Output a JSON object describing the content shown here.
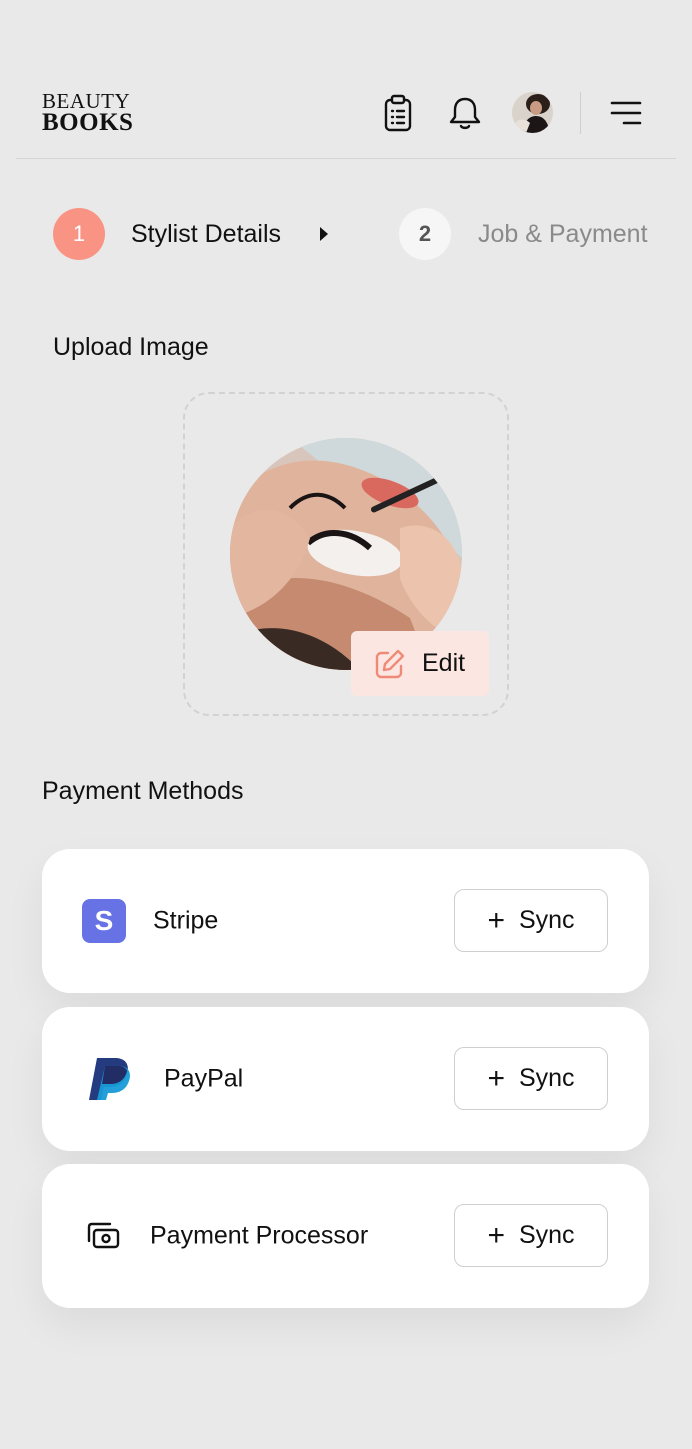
{
  "brand": {
    "line1": "BEAUTY",
    "line2": "BOOKS"
  },
  "header": {
    "icons": [
      "clipboard-icon",
      "bell-icon",
      "avatar",
      "menu-icon"
    ]
  },
  "stepper": {
    "steps": [
      {
        "number": "1",
        "label": "Stylist Details",
        "active": true
      },
      {
        "number": "2",
        "label": "Job & Payment",
        "active": false
      }
    ]
  },
  "upload": {
    "title": "Upload Image",
    "edit_label": "Edit"
  },
  "payment": {
    "title": "Payment Methods",
    "methods": [
      {
        "name": "Stripe",
        "icon": "stripe-icon",
        "icon_letter": "S",
        "action": "Sync",
        "action_icon": "+"
      },
      {
        "name": "PayPal",
        "icon": "paypal-icon",
        "action": "Sync",
        "action_icon": "+"
      },
      {
        "name": "Payment Processor",
        "icon": "payment-processor-icon",
        "action": "Sync",
        "action_icon": "+"
      }
    ]
  },
  "colors": {
    "accent": "#f99484",
    "edit_bg": "#fce6e1",
    "stripe": "#6772e5",
    "paypal_dark": "#253b80",
    "paypal_light": "#179bd7",
    "background": "#e9e9e9"
  }
}
